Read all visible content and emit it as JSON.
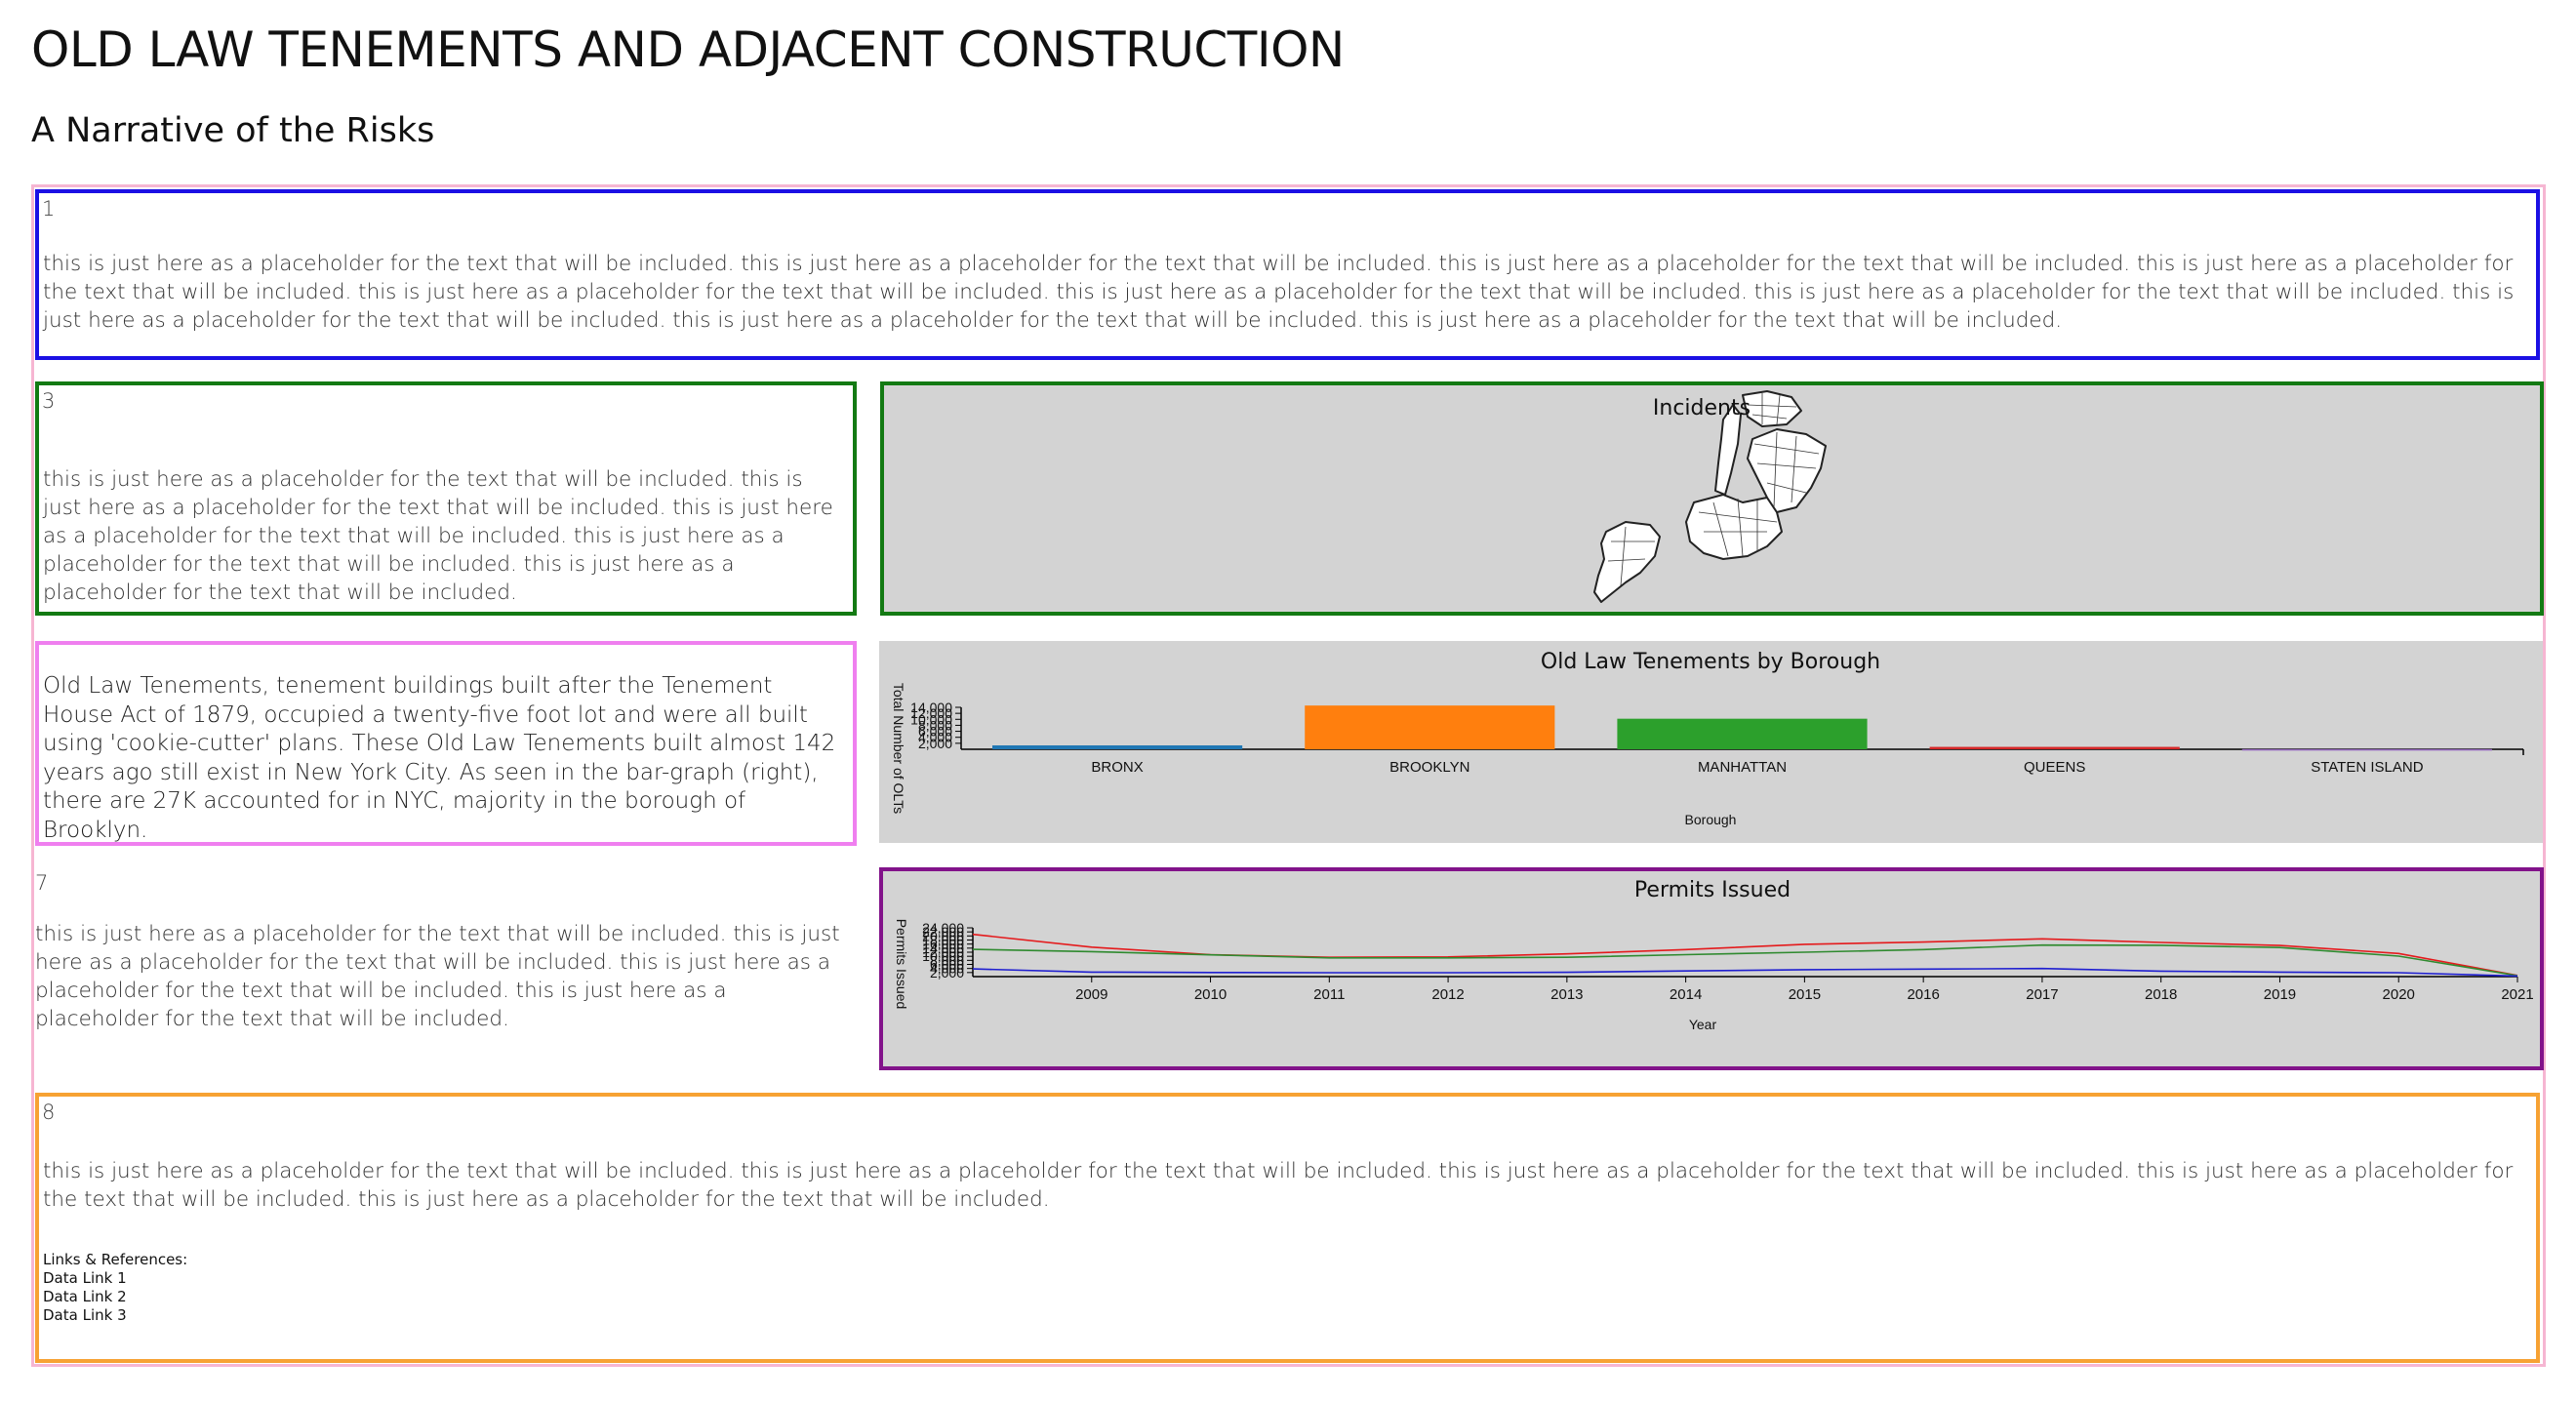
{
  "header": {
    "title": "OLD LAW TENEMENTS AND ADJACENT CONSTRUCTION",
    "subtitle": "A Narrative of the Risks"
  },
  "panels": {
    "p1": {
      "number": "1",
      "text": "this is just here as a placeholder for the text that will be included. this is just here as a placeholder for the text that will be included. this is just here as a placeholder for the text that will be included. this is just here as a placeholder for the text that will be included. this is just here as a placeholder for the text that will be included. this is just here as a placeholder for the text that will be included. this is just here as a placeholder for the text that will be included. this is just here as a placeholder for the text that will be included. this is just here as a placeholder for the text that will be included. this is just here as a placeholder for the text that will be included."
    },
    "p3": {
      "number": "3",
      "text": "this is just here as a placeholder for the text that will be included. this is just here as a placeholder for the text that will be included. this is just here as a placeholder for the text that will be included. this is just here as a placeholder for the text that will be included. this is just here as a placeholder for the text that will be included."
    },
    "olt": {
      "text": "Old Law Tenements, tenement buildings built after the Tenement House Act of 1879, occupied a twenty-five foot lot and were all built using 'cookie-cutter' plans. These Old Law Tenements built almost 142 years ago still exist in New York City. As seen in the bar-graph (right), there are 27K accounted for in NYC, majority in the borough of Brooklyn."
    },
    "p7": {
      "number": "7",
      "text": "this is just here as a placeholder for the text that will be included. this is just here as a placeholder for the text that will be included. this is just here as a placeholder for the text that will be included. this is just here as a placeholder for the text that will be included."
    },
    "p8": {
      "number": "8",
      "text": "this is just here as a placeholder for the text that will be included. this is just here as a placeholder for the text that will be included. this is just here as a placeholder for the text that will be included. this is just here as a placeholder for the text that will be included. this is just here as a placeholder for the text that will be included.",
      "links_heading": "Links & References:",
      "links": [
        "Data Link 1",
        "Data Link 2",
        "Data Link 3"
      ]
    }
  },
  "map": {
    "title": "Incidents",
    "icon": "nyc-borough-map"
  },
  "colors": {
    "panel_bg": "#d3d3d3",
    "blue": "#1b10e4",
    "green": "#137a13",
    "pink": "#ef7fef",
    "purple": "#82138a",
    "orange": "#f7a233",
    "outer": "#f6b6d2"
  },
  "chart_data": [
    {
      "type": "bar",
      "title": "Old Law Tenements by Borough",
      "xlabel": "Borough",
      "ylabel": "Total Number of OLTs",
      "categories": [
        "BRONX",
        "BROOKLYN",
        "MANHATTAN",
        "QUEENS",
        "STATEN ISLAND"
      ],
      "values": [
        1300,
        14600,
        10200,
        800,
        50
      ],
      "colors": [
        "#1f77b4",
        "#ff7f0e",
        "#2ca02c",
        "#d62728",
        "#9467bd"
      ],
      "ylim": [
        0,
        14000
      ],
      "yticks": [
        2000,
        4000,
        6000,
        8000,
        10000,
        12000,
        14000
      ],
      "ytick_labels": [
        "2,000",
        "4,000",
        "6,000",
        "8,000",
        "10,000",
        "12,000",
        "14,000"
      ],
      "grid": false,
      "legend": "none"
    },
    {
      "type": "line",
      "title": "Permits Issued",
      "xlabel": "Year",
      "ylabel": "Permits Issued",
      "x": [
        2008,
        2009,
        2010,
        2011,
        2012,
        2013,
        2014,
        2015,
        2016,
        2017,
        2018,
        2019,
        2020,
        2021
      ],
      "xticks": [
        "2009",
        "2010",
        "2011",
        "2012",
        "2013",
        "2014",
        "2015",
        "2016",
        "2017",
        "2018",
        "2019",
        "2020",
        "2021"
      ],
      "series": [
        {
          "color": "#e41a1c",
          "values": [
            20800,
            14500,
            10800,
            9500,
            9700,
            11200,
            13300,
            15900,
            17000,
            18600,
            16800,
            15300,
            11400,
            600
          ]
        },
        {
          "color": "#2f8a2f",
          "values": [
            13400,
            12300,
            10700,
            9200,
            9200,
            9500,
            10800,
            12000,
            13300,
            15500,
            15400,
            14300,
            10100,
            500
          ]
        },
        {
          "color": "#1f1fd0",
          "values": [
            3800,
            2200,
            2000,
            1900,
            1900,
            2100,
            2800,
            3400,
            3700,
            4000,
            2700,
            2200,
            1900,
            300
          ]
        }
      ],
      "ylim": [
        0,
        24000
      ],
      "yticks": [
        2000,
        4000,
        6000,
        8000,
        10000,
        12000,
        14000,
        16000,
        18000,
        20000,
        22000,
        24000
      ],
      "ytick_labels": [
        "2,000",
        "4,000",
        "6,000",
        "8,000",
        "10,000",
        "12,000",
        "14,000",
        "16,000",
        "18,000",
        "20,000",
        "22,000",
        "24,000"
      ],
      "grid": false,
      "legend": "none"
    }
  ]
}
